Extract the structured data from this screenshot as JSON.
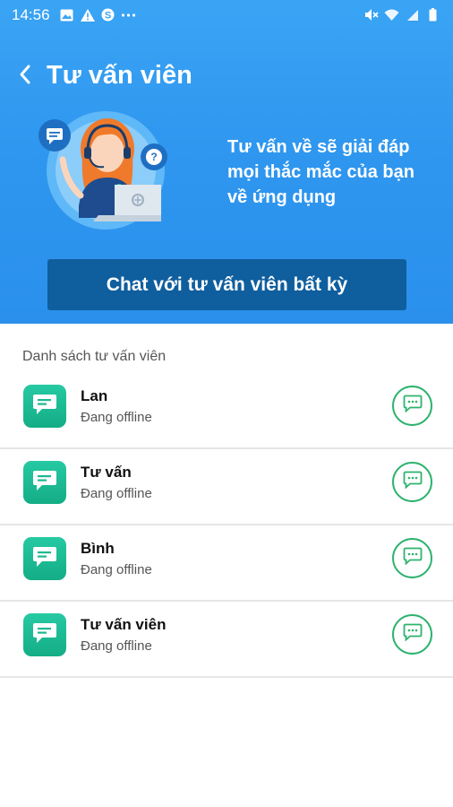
{
  "status_bar": {
    "time": "14:56",
    "left_icons": [
      "gallery-icon",
      "alert-icon",
      "skype-icon",
      "more-dots-icon"
    ],
    "right_icons": [
      "mute-icon",
      "wifi-icon",
      "signal-icon",
      "battery-icon"
    ]
  },
  "header": {
    "title": "Tư vấn viên",
    "back_icon": "back-arrow-icon"
  },
  "hero": {
    "description": "Tư vấn về sẽ giải đáp mọi thắc mắc của bạn về ứng dụng",
    "chat_button_label": "Chat với tư vấn viên bất kỳ"
  },
  "list": {
    "header": "Danh sách tư vấn viên",
    "consultants": [
      {
        "name": "Lan",
        "status": "Đang offline"
      },
      {
        "name": "Tư vấn",
        "status": "Đang offline"
      },
      {
        "name": "Bình",
        "status": "Đang offline"
      },
      {
        "name": "Tư vấn viên",
        "status": "Đang offline"
      }
    ]
  },
  "colors": {
    "hero_blue": "#2f97ef",
    "button_dark_blue": "#0f5e9e",
    "avatar_green": "#1cb892",
    "chat_circle_green": "#2eb36e"
  }
}
